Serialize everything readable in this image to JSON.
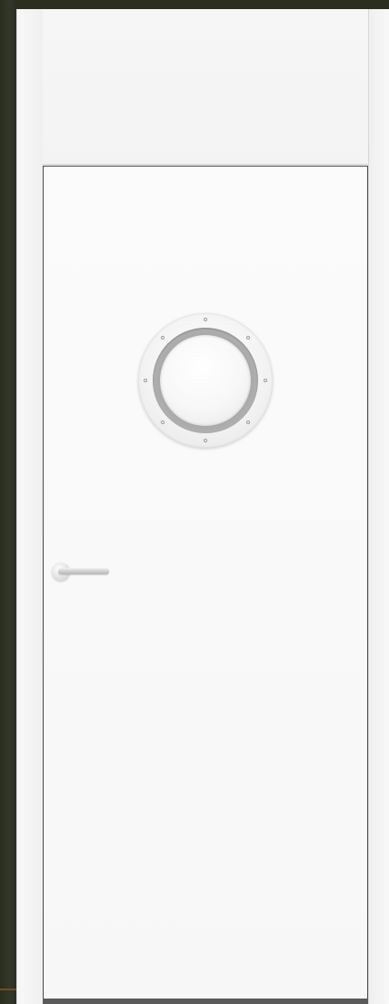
{
  "scene": {
    "subject": "white-flush-door-with-porthole-window",
    "icons": [
      "porthole-icon",
      "lever-handle-icon"
    ],
    "colors": {
      "wall": "#2c2f20",
      "frame": "#f2f2f2",
      "door": "#f9f9f9",
      "door-edge": "#4a4a4a",
      "porthole-ring": "#a8a8a8",
      "handle": "#cfcfcf"
    }
  }
}
